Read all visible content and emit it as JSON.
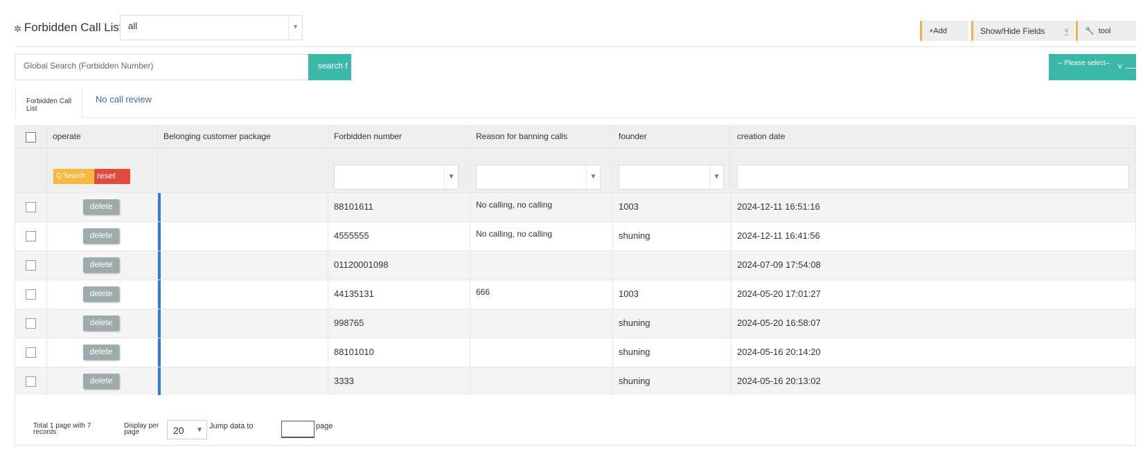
{
  "header": {
    "title": "Forbidden Call List",
    "filter_value": "all",
    "add_label": "+Add",
    "fields_label": "Show/Hide Fields",
    "fields_arrow": "v",
    "tool_label": "tool"
  },
  "search": {
    "placeholder": "Global Search (Forbidden Number)",
    "button_label": "search f",
    "select_label": "– Please select–",
    "select_arrow": "v"
  },
  "tabs": {
    "active": "Forbidden Call List",
    "other": "No call review"
  },
  "table": {
    "columns": [
      "operate",
      "Belonging customer package",
      "Forbidden number",
      "Reason for banning calls",
      "founder",
      "creation date"
    ],
    "search_label": "Q Search",
    "reset_label": "reset",
    "delete_label": "delete",
    "rows": [
      {
        "number": "88101611",
        "reason": "No calling, no calling",
        "founder": "1003",
        "date": "2024-12-11 16:51:16"
      },
      {
        "number": "4555555",
        "reason": "No calling, no calling",
        "founder": "shuning",
        "date": "2024-12-11 16:41:56"
      },
      {
        "number": "01120001098",
        "reason": "",
        "founder": "",
        "date": "2024-07-09 17:54:08"
      },
      {
        "number": "44135131",
        "reason": "666",
        "founder": "1003",
        "date": "2024-05-20 17:01:27"
      },
      {
        "number": "998765",
        "reason": "",
        "founder": "shuning",
        "date": "2024-05-20 16:58:07"
      },
      {
        "number": "88101010",
        "reason": "",
        "founder": "shuning",
        "date": "2024-05-16 20:14:20"
      },
      {
        "number": "3333",
        "reason": "",
        "founder": "shuning",
        "date": "2024-05-16 20:13:02"
      }
    ]
  },
  "pager": {
    "total_text": "Total 1 page with 7 records",
    "per_page_label": "Display per page",
    "page_size": "20",
    "jump_label": "Jump data to",
    "page_unit": "page"
  },
  "colors": {
    "teal": "#3bb8a8",
    "orange": "#f5b840",
    "red": "#e24b3b",
    "blue_bar": "#3a7cc0"
  }
}
